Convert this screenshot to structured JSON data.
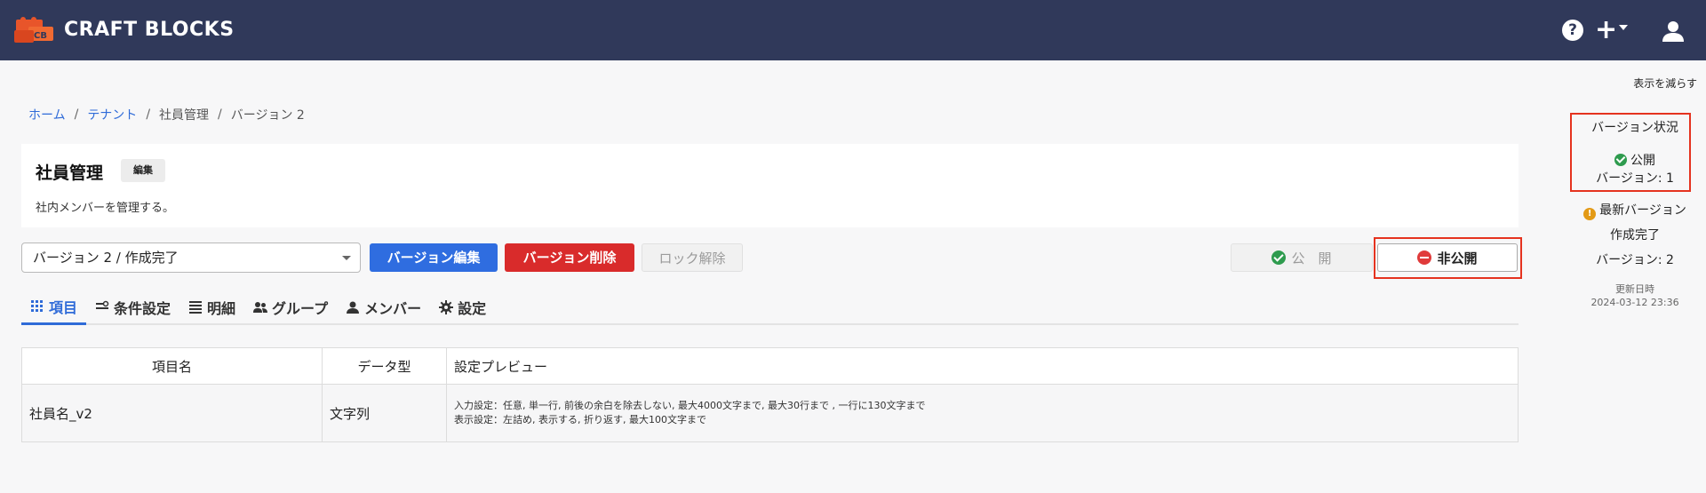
{
  "app": {
    "brand": "CRAFT BLOCKS"
  },
  "topbar": {
    "help_icon": "help-circle-icon",
    "help_glyph": "?",
    "add_icon": "plus-icon",
    "add_glyph": "+",
    "user_icon": "user-icon"
  },
  "hide_link": "表示を減らす",
  "breadcrumb": {
    "items": [
      "ホーム",
      "テナント",
      "社員管理",
      "バージョン 2"
    ],
    "separator": "/"
  },
  "page": {
    "title": "社員管理",
    "edit_badge": "編集",
    "description": "社内メンバーを管理する。"
  },
  "toolbar": {
    "version_select": "バージョン 2 / 作成完了",
    "edit_version": "バージョン編集",
    "delete_version": "バージョン削除",
    "unlock": "ロック解除",
    "publish": "公　開",
    "unpublish": "非公開"
  },
  "tabs": [
    {
      "label": "項目",
      "icon": "grid-icon",
      "active": true
    },
    {
      "label": "条件設定",
      "icon": "filter-icon",
      "active": false
    },
    {
      "label": "明細",
      "icon": "list-icon",
      "active": false
    },
    {
      "label": "グループ",
      "icon": "group-icon",
      "active": false
    },
    {
      "label": "メンバー",
      "icon": "person-icon",
      "active": false
    },
    {
      "label": "設定",
      "icon": "gear-icon",
      "active": false
    }
  ],
  "table": {
    "headers": [
      "項目名",
      "データ型",
      "設定プレビュー"
    ],
    "rows": [
      {
        "name": "社員名_v2",
        "type": "文字列",
        "preview_input": "入力設定：任意, 単一行, 前後の余白を除去しない, 最大4000文字まで, 最大30行まで , 一行に130文字まで",
        "preview_display": "表示設定：左詰め, 表示する, 折り返す, 最大100文字まで"
      }
    ]
  },
  "sidebar": {
    "status_title": "バージョン状況",
    "published_label": "公開",
    "published_version": "バージョン: 1",
    "latest_label": "最新バージョン",
    "latest_status": "作成完了",
    "latest_version": "バージョン: 2",
    "updated_label": "更新日時",
    "updated_at": "2024-03-12 23:36",
    "warning_glyph": "!"
  },
  "colors": {
    "topbar": "#30395a",
    "primary": "#2f6de0",
    "danger": "#d92b2b",
    "success": "#2e9b4e",
    "warning": "#e39a16",
    "highlight": "#e5331f"
  }
}
